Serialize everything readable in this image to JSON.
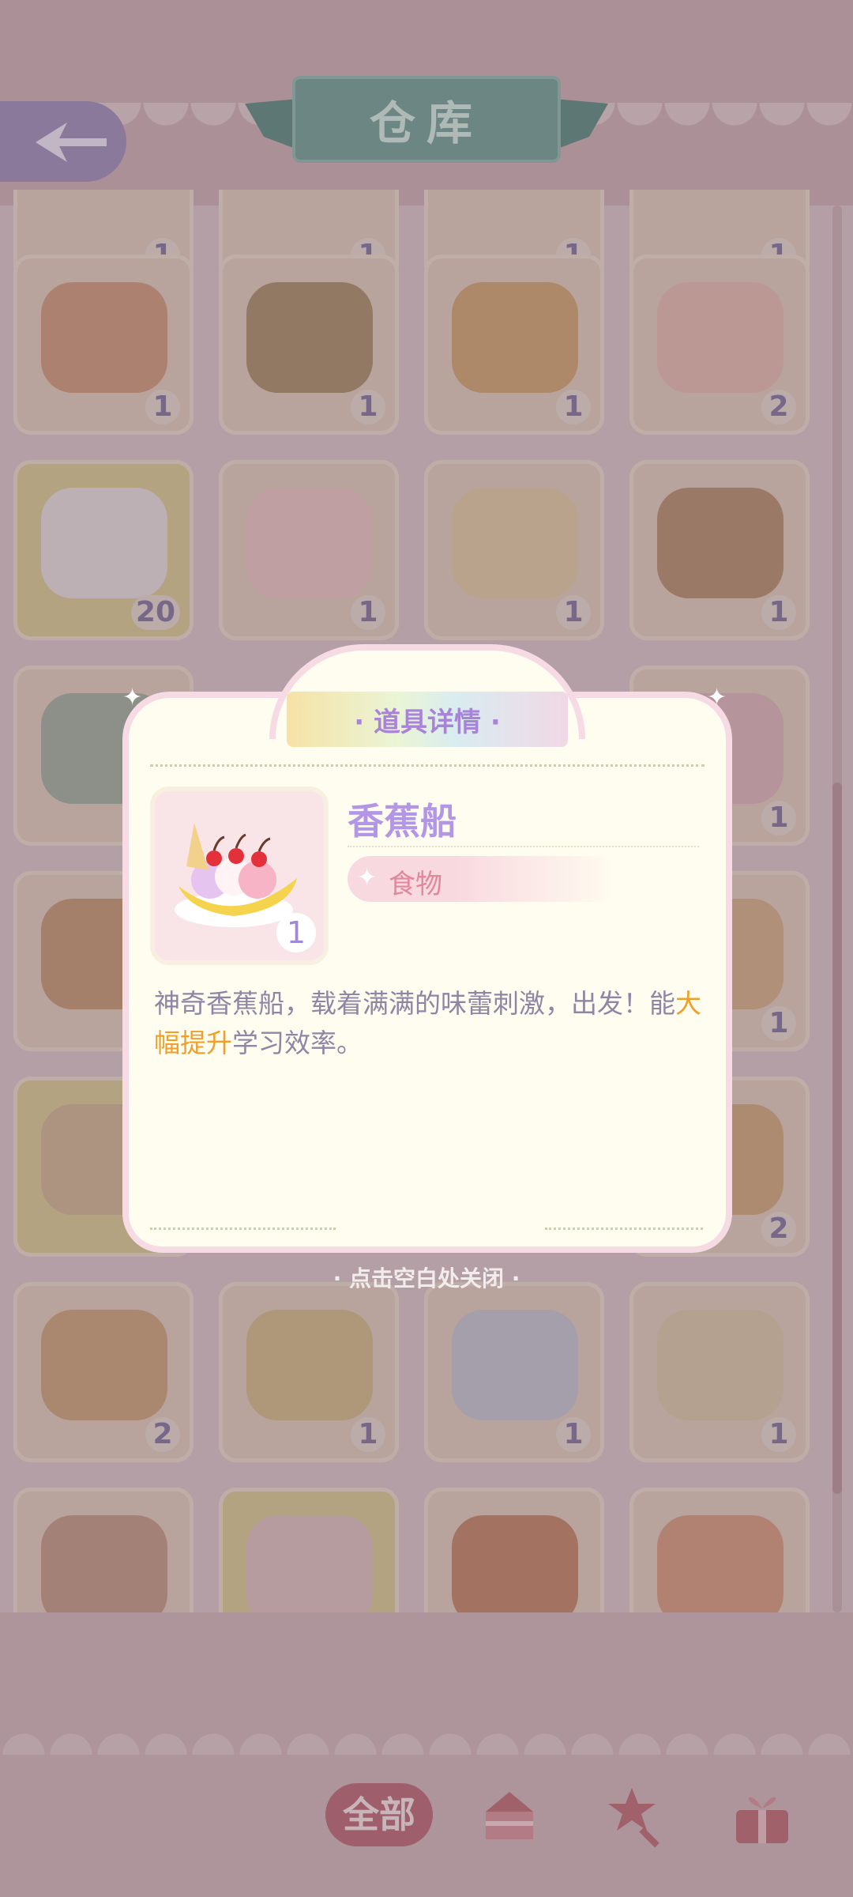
{
  "header": {
    "title": "仓库",
    "back_icon": "back-arrow-icon"
  },
  "inventory": {
    "rows": [
      {
        "items": [
          {
            "name": "item-partial-1",
            "count": "1"
          },
          {
            "name": "item-partial-2",
            "count": "1"
          },
          {
            "name": "item-partial-3",
            "count": "1"
          },
          {
            "name": "item-partial-4",
            "count": "1"
          }
        ]
      },
      {
        "items": [
          {
            "name": "grilled-skewers",
            "count": "1"
          },
          {
            "name": "fish-roll",
            "count": "1"
          },
          {
            "name": "hot-dog",
            "count": "1"
          },
          {
            "name": "cream-cake",
            "count": "2"
          }
        ]
      },
      {
        "items": [
          {
            "name": "paper-crane",
            "count": "20"
          },
          {
            "name": "puzzle-ticket",
            "count": "1"
          },
          {
            "name": "soup-bowl",
            "count": "1"
          },
          {
            "name": "grilled-fish",
            "count": "1"
          }
        ]
      },
      {
        "items": [
          {
            "name": "scissors",
            "count": ""
          },
          {
            "name": "hidden",
            "count": ""
          },
          {
            "name": "hidden",
            "count": ""
          },
          {
            "name": "book",
            "count": "1"
          }
        ]
      },
      {
        "items": [
          {
            "name": "sandwich",
            "count": ""
          },
          {
            "name": "hidden",
            "count": ""
          },
          {
            "name": "hidden",
            "count": ""
          },
          {
            "name": "roast-chicken",
            "count": "1"
          }
        ]
      },
      {
        "items": [
          {
            "name": "flour-bag",
            "count": ""
          },
          {
            "name": "hidden",
            "count": ""
          },
          {
            "name": "hidden",
            "count": ""
          },
          {
            "name": "wrap",
            "count": "2"
          }
        ]
      },
      {
        "items": [
          {
            "name": "bread-loaf",
            "count": "2"
          },
          {
            "name": "eggs-benedict",
            "count": "1"
          },
          {
            "name": "acting-book",
            "count": "1"
          },
          {
            "name": "craft-book",
            "count": "1"
          }
        ]
      },
      {
        "items": [
          {
            "name": "drink-jar",
            "count": ""
          },
          {
            "name": "photo-cards",
            "count": ""
          },
          {
            "name": "fried-chicken",
            "count": ""
          },
          {
            "name": "hot-dog-2",
            "count": ""
          }
        ]
      }
    ]
  },
  "dialog": {
    "title": "· 道具详情 ·",
    "item": {
      "name": "香蕉船",
      "count": "1",
      "category": "食物",
      "description_part1": "神奇香蕉船，载着满满的味蕾刺激，出发！能",
      "description_highlight": "大幅提升",
      "description_part2": "学习效率。"
    },
    "close_hint": "· 点击空白处关闭 ·"
  },
  "tabs": {
    "all_label": "全部",
    "icons": [
      "cake-icon",
      "star-wand-icon",
      "gift-box-icon"
    ]
  },
  "colors": {
    "accent_purple": "#b396e6",
    "highlight": "#f0a02a",
    "category": "#e3879a",
    "tab_active": "#b65f70"
  }
}
